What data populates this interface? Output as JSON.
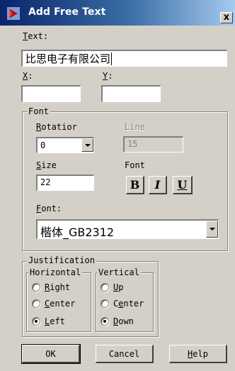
{
  "window": {
    "title": "Add Free Text",
    "close_glyph": "x",
    "icon": "app-icon"
  },
  "text_field": {
    "label_accel": "T",
    "label_rest": "ext:",
    "value": "比思电子有限公司"
  },
  "x_field": {
    "label_accel": "X",
    "label_rest": ":",
    "value": ""
  },
  "y_field": {
    "label_accel": "Y",
    "label_rest": ":",
    "value": ""
  },
  "font_group": {
    "legend": "Font",
    "rotation": {
      "label_accel": "R",
      "label_rest": "otatior",
      "value": "0"
    },
    "line": {
      "label": "Line",
      "value": "15"
    },
    "size": {
      "label_accel": "S",
      "label_rest": "ize",
      "value": "22"
    },
    "style_label": "Font",
    "bold_label": "B",
    "italic_label": "I",
    "underline_label": "U",
    "font": {
      "label_accel": "F",
      "label_rest": "ont:",
      "value": "楷体_GB2312"
    }
  },
  "justification": {
    "legend": "Justification",
    "horizontal": {
      "legend": "Horizontal",
      "options": [
        {
          "accel": "R",
          "rest": "ight",
          "checked": false
        },
        {
          "accel": "C",
          "rest": "enter",
          "checked": false
        },
        {
          "accel": "L",
          "rest": "eft",
          "checked": true
        }
      ]
    },
    "vertical": {
      "legend": "Vertical",
      "options": [
        {
          "accel": "U",
          "rest": "p",
          "checked": false
        },
        {
          "pre": "C",
          "accel": "e",
          "rest": "nter",
          "checked": false
        },
        {
          "accel": "D",
          "rest": "own",
          "checked": true
        }
      ]
    }
  },
  "buttons": {
    "ok": "OK",
    "cancel": "Cancel",
    "help_accel": "H",
    "help_rest": "elp"
  },
  "colors": {
    "title_start": "#0a246a",
    "title_end": "#a6caf0",
    "face": "#d4d0c8"
  }
}
